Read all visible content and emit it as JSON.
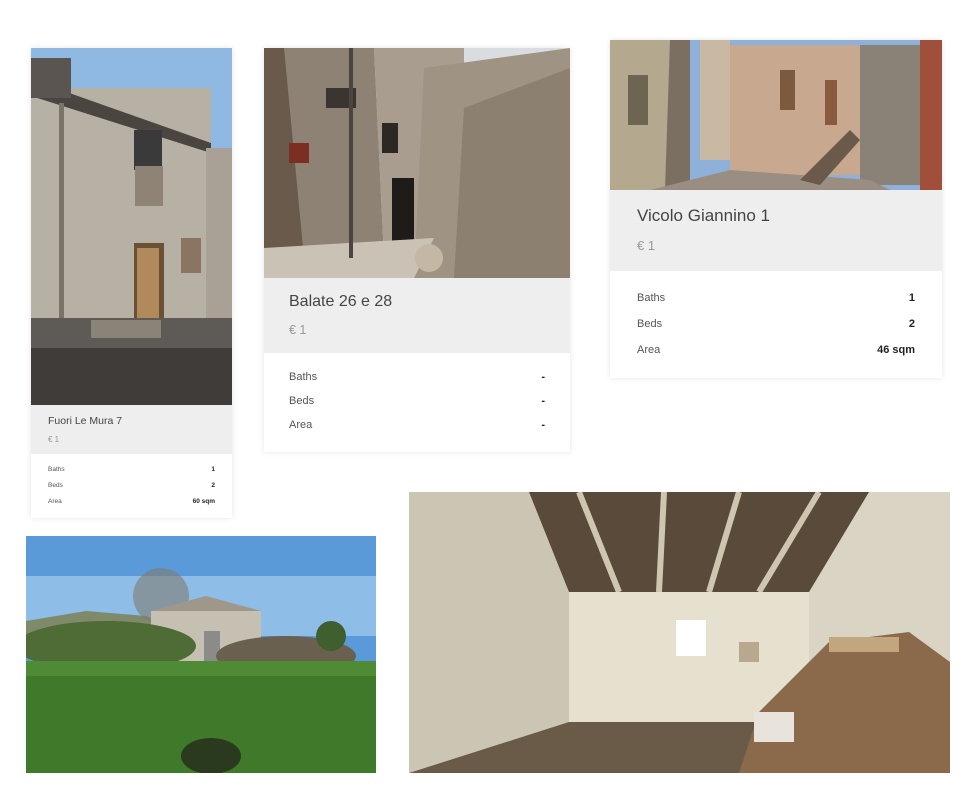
{
  "listings": [
    {
      "title": "Fuori Le Mura 7",
      "price": "€ 1",
      "rows": [
        {
          "label": "Baths",
          "value": "1"
        },
        {
          "label": "Beds",
          "value": "2"
        },
        {
          "label": "Area",
          "value": "60 sqm"
        }
      ]
    },
    {
      "title": "Balate 26 e 28",
      "price": "€ 1",
      "rows": [
        {
          "label": "Baths",
          "value": "-"
        },
        {
          "label": "Beds",
          "value": "-"
        },
        {
          "label": "Area",
          "value": "-"
        }
      ]
    },
    {
      "title": "Vicolo Giannino 1",
      "price": "€ 1",
      "rows": [
        {
          "label": "Baths",
          "value": "1"
        },
        {
          "label": "Beds",
          "value": "2"
        },
        {
          "label": "Area",
          "value": "46 sqm"
        }
      ]
    }
  ],
  "colors": {
    "card_header_bg": "#eeeeee",
    "title_text": "#444444",
    "price_text": "#999999",
    "value_text": "#222222",
    "sky": "#8fb9e3",
    "stone": "#b9b2a6",
    "grass": "#4f8a35"
  }
}
